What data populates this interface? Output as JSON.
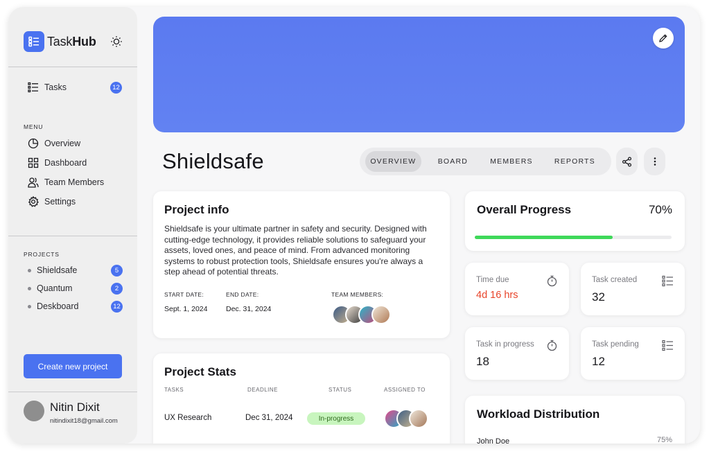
{
  "brand": {
    "name_regular": "Task",
    "name_bold": "Hub"
  },
  "sidebar": {
    "tasks": {
      "label": "Tasks",
      "count": "12"
    },
    "menu_label": "MENU",
    "menu": [
      {
        "label": "Overview",
        "icon": "pie-chart-icon"
      },
      {
        "label": "Dashboard",
        "icon": "grid-icon"
      },
      {
        "label": "Team Members",
        "icon": "users-icon"
      },
      {
        "label": "Settings",
        "icon": "gear-icon"
      }
    ],
    "projects_label": "PROJECTS",
    "projects": [
      {
        "label": "Shieldsafe",
        "count": "5"
      },
      {
        "label": "Quantum",
        "count": "2"
      },
      {
        "label": "Deskboard",
        "count": "12"
      }
    ],
    "create_button": "Create new project",
    "user": {
      "name": "Nitin Dixit",
      "email": "nitindixit18@gmail.com"
    }
  },
  "project": {
    "title": "Shieldsafe",
    "tabs": [
      "OVERVIEW",
      "BOARD",
      "MEMBERS",
      "REPORTS"
    ],
    "active_tab": "OVERVIEW"
  },
  "info": {
    "title": "Project info",
    "description": "Shieldsafe is your ultimate partner in safety and security. Designed with cutting-edge technology, it provides reliable solutions to safeguard your assets, loved ones, and peace of mind. From advanced monitoring systems to robust protection tools, Shieldsafe ensures you're always a step ahead of potential threats.",
    "start_label": "START DATE:",
    "start_value": "Sept. 1, 2024",
    "end_label": "END DATE:",
    "end_value": "Dec. 31, 2024",
    "team_label": "TEAM MEMBERS:"
  },
  "stats": {
    "title": "Project Stats",
    "columns": [
      "TASKS",
      "DEADLINE",
      "STATUS",
      "ASSIGNED TO"
    ],
    "row": {
      "task": "UX Research",
      "deadline": "Dec 31, 2024",
      "status": "In-progress"
    }
  },
  "progress": {
    "title": "Overall Progress",
    "percent_label": "70%",
    "value": 0.7
  },
  "cards": {
    "time_due": {
      "label": "Time due",
      "value": "4d 16 hrs"
    },
    "task_created": {
      "label": "Task created",
      "value": "32"
    },
    "task_in_progress": {
      "label": "Task in progress",
      "value": "18"
    },
    "task_pending": {
      "label": "Task pending",
      "value": "12"
    }
  },
  "workload": {
    "title": "Workload Distribution",
    "rows": [
      {
        "name": "John Doe",
        "percent": "75%"
      }
    ]
  },
  "colors": {
    "accent": "#4a72f0",
    "banner": "#5b7af0",
    "progress": "#3fd85a",
    "due": "#e8442a",
    "status_bg": "#c8f5be"
  }
}
